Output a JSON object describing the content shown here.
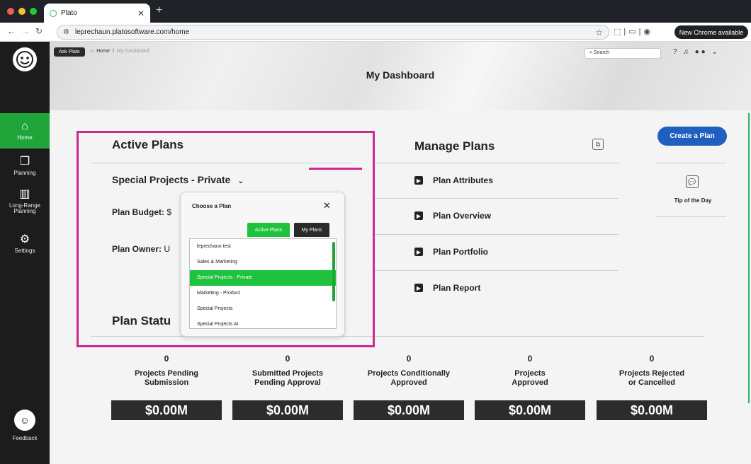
{
  "browser": {
    "tab_title": "Plato",
    "url": "leprechaun.platosoftware.com/home",
    "chrome_badge": "New Chrome available"
  },
  "header": {
    "ask_button": "Ask Plato",
    "breadcrumb_home": "Home",
    "breadcrumb_sep": "/",
    "breadcrumb_current": "My Dashboard",
    "search_placeholder": "Search",
    "page_title": "My Dashboard"
  },
  "sidebar": {
    "items": [
      {
        "label": "Home",
        "icon": "home-icon"
      },
      {
        "label": "Planning",
        "icon": "copy-icon"
      },
      {
        "label": "Long-Range Planning",
        "icon": "map-icon"
      },
      {
        "label": "Settings",
        "icon": "gear-icon"
      }
    ],
    "feedback": "Feedback"
  },
  "active_plans": {
    "title": "Active Plans",
    "plan_name": "Special Projects - Private",
    "budget_label": "Plan Budget:",
    "budget_value": "$",
    "owner_label": "Plan Owner:",
    "owner_value": "U"
  },
  "manage_plans": {
    "title": "Manage Plans",
    "items": [
      "Plan Attributes",
      "Plan Overview",
      "Plan Portfolio",
      "Plan Report"
    ]
  },
  "right_panel": {
    "create_button": "Create a Plan",
    "tip_label": "Tip of the Day"
  },
  "plan_status": {
    "title": "Plan Statu",
    "columns": [
      {
        "count": "0",
        "label_line1": "Projects Pending",
        "label_line2": "Submission",
        "money": "$0.00M"
      },
      {
        "count": "0",
        "label_line1": "Submitted Projects",
        "label_line2": "Pending Approval",
        "money": "$0.00M"
      },
      {
        "count": "0",
        "label_line1": "Projects Conditionally",
        "label_line2": "Approved",
        "money": "$0.00M"
      },
      {
        "count": "0",
        "label_line1": "Projects",
        "label_line2": "Approved",
        "money": "$0.00M"
      },
      {
        "count": "0",
        "label_line1": "Projects Rejected",
        "label_line2": "or Cancelled",
        "money": "$0.00M"
      }
    ]
  },
  "popup": {
    "title": "Choose a Plan",
    "active_tab": "Active Plans",
    "my_tab": "My Plans",
    "items": [
      "leprechaun test",
      "Sales & Marketing",
      "Special Projects - Private",
      "Marketing - Product",
      "Special Projects",
      "Special Projects AI"
    ],
    "selected_index": 2
  },
  "colors": {
    "accent_green": "#1fc23d",
    "highlight_pink": "#cc2a8f",
    "primary_blue": "#1f5fbf"
  }
}
